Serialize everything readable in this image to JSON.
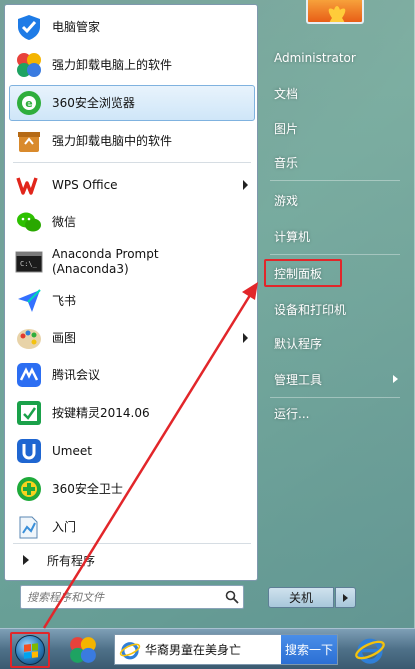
{
  "left_panel": {
    "programs": [
      {
        "label": "电脑管家",
        "icon": "tencent-pc-manager-icon",
        "highlight": false,
        "submenu": false
      },
      {
        "label": "强力卸载电脑上的软件",
        "icon": "uninstall-clover-icon",
        "highlight": false,
        "submenu": false
      },
      {
        "label": "360安全浏览器",
        "icon": "360-browser-icon",
        "highlight": true,
        "submenu": false
      },
      {
        "label": "强力卸载电脑中的软件",
        "icon": "recycle-box-icon",
        "highlight": false,
        "submenu": false
      },
      {
        "label": "WPS Office",
        "icon": "wps-icon",
        "highlight": false,
        "submenu": true
      },
      {
        "label": "微信",
        "icon": "wechat-icon",
        "highlight": false,
        "submenu": false
      },
      {
        "label": "Anaconda Prompt (Anaconda3)",
        "line1": "Anaconda Prompt",
        "line2": "(Anaconda3)",
        "icon": "terminal-icon",
        "highlight": false,
        "submenu": false
      },
      {
        "label": "飞书",
        "icon": "feishu-icon",
        "highlight": false,
        "submenu": false
      },
      {
        "label": "画图",
        "icon": "paint-icon",
        "highlight": false,
        "submenu": true
      },
      {
        "label": "腾讯会议",
        "icon": "tencent-meeting-icon",
        "highlight": false,
        "submenu": false
      },
      {
        "label": "按键精灵2014.06",
        "icon": "key-sprite-icon",
        "highlight": false,
        "submenu": false
      },
      {
        "label": "Umeet",
        "icon": "umeet-icon",
        "highlight": false,
        "submenu": false
      },
      {
        "label": "360安全卫士",
        "icon": "360-safe-icon",
        "highlight": false,
        "submenu": false
      },
      {
        "label": "入门",
        "icon": "getting-started-icon",
        "highlight": false,
        "submenu": false
      }
    ],
    "all_programs_label": "所有程序",
    "search_placeholder": "搜索程序和文件"
  },
  "right_panel": {
    "items": [
      {
        "label": "Administrator",
        "submenu": false,
        "boxed": false
      },
      {
        "label": "文档",
        "submenu": false,
        "boxed": false
      },
      {
        "label": "图片",
        "submenu": false,
        "boxed": false
      },
      {
        "label": "音乐",
        "submenu": false,
        "boxed": false
      },
      {
        "label": "游戏",
        "submenu": false,
        "boxed": false
      },
      {
        "label": "计算机",
        "submenu": false,
        "boxed": false
      },
      {
        "label": "控制面板",
        "submenu": false,
        "boxed": true
      },
      {
        "label": "设备和打印机",
        "submenu": false,
        "boxed": false
      },
      {
        "label": "默认程序",
        "submenu": false,
        "boxed": false
      },
      {
        "label": "管理工具",
        "submenu": true,
        "boxed": false
      },
      {
        "label": "运行...",
        "submenu": false,
        "boxed": false
      }
    ],
    "shutdown_label": "关机"
  },
  "taskbar": {
    "search_query": "华裔男童在美身亡",
    "search_button": "搜索一下"
  },
  "colors": {
    "highlight_border": "#e2262a",
    "annotation_arrow": "#e2262a"
  }
}
